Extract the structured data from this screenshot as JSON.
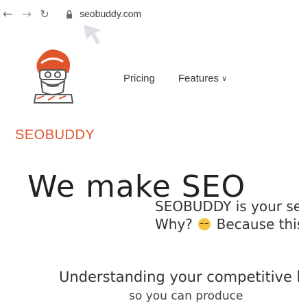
{
  "browser": {
    "back_icon": "arrow-left-icon",
    "forward_icon": "arrow-right-icon",
    "reload_icon": "reload-icon",
    "url": "seobuddy.com"
  },
  "site": {
    "brand": "SEOBUDDY",
    "brand_color": "#e0542c",
    "nav": {
      "pricing": "Pricing",
      "features": "Features"
    }
  },
  "hero": {
    "title": "We make SEO",
    "subtitle_line1": "SEOBUDDY is your secret",
    "subtitle_line2_before": "Why?",
    "subtitle_line2_after": "Because this"
  },
  "section": {
    "heading": "Understanding your competitive l",
    "sub": "so you can produce"
  }
}
